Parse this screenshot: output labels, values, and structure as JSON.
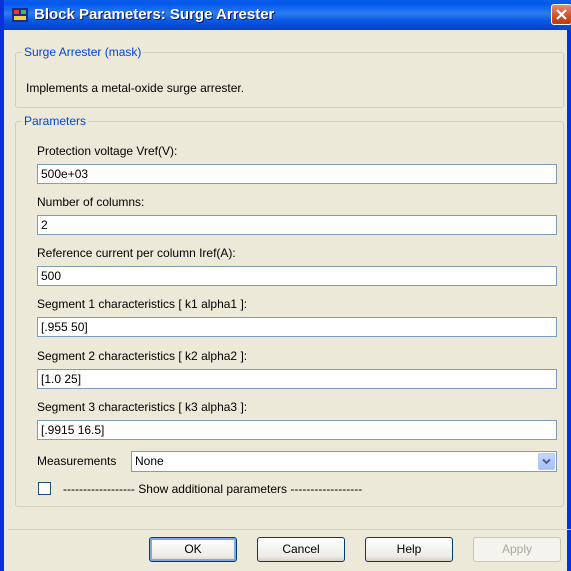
{
  "window": {
    "title": "Block Parameters: Surge Arrester",
    "icon": "simulink-block-icon",
    "close_icon": "close-icon"
  },
  "mask": {
    "legend": "Surge Arrester (mask)",
    "description": "Implements a metal-oxide surge arrester."
  },
  "params": {
    "legend": "Parameters",
    "fields": [
      {
        "label": "Protection voltage  Vref(V):",
        "value": "500e+03"
      },
      {
        "label": "Number of columns:",
        "value": "2"
      },
      {
        "label": "Reference current per column Iref(A):",
        "value": "500"
      },
      {
        "label": "Segment 1 characteristics [ k1 alpha1 ]:",
        "value": "[.955 50]"
      },
      {
        "label": "Segment 2 characteristics [ k2 alpha2 ]:",
        "value": "[1.0 25]"
      },
      {
        "label": "Segment 3 characteristics [ k3 alpha3 ]:",
        "value": "[.9915 16.5]"
      }
    ],
    "measurements": {
      "label": "Measurements",
      "selected": "None"
    },
    "show_additional": {
      "label": "------------------ Show additional parameters ------------------",
      "checked": false
    }
  },
  "buttons": {
    "ok": "OK",
    "cancel": "Cancel",
    "help": "Help",
    "apply": "Apply"
  },
  "colors": {
    "titlebar": "#0058ee",
    "dialog_bg": "#ece9d8",
    "legend_text": "#0046d5",
    "close_button": "#d24d22"
  }
}
